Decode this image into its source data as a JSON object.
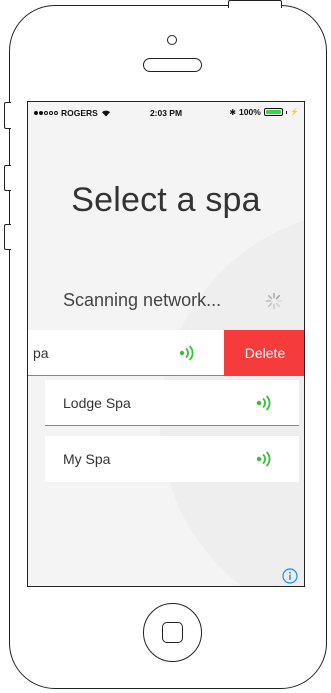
{
  "status_bar": {
    "carrier": "ROGERS",
    "signal_dots": [
      true,
      true,
      false,
      false,
      false
    ],
    "time": "2:03 PM",
    "battery_percent": "100%",
    "battery_level": 1.0,
    "icons": [
      "wifi-icon",
      "bluetooth-icon",
      "battery-icon",
      "charging-bolt-icon"
    ]
  },
  "title": "Select a spa",
  "scanning_text": "Scanning network...",
  "spas": [
    {
      "name": "pa",
      "signal_icon": "wifi-signal-icon",
      "swiped": true,
      "delete_label": "Delete"
    },
    {
      "name": "Lodge Spa",
      "signal_icon": "wifi-signal-icon",
      "swiped": false
    },
    {
      "name": "My Spa",
      "signal_icon": "wifi-signal-icon",
      "swiped": false
    }
  ],
  "colors": {
    "signal_green": "#2ec234",
    "delete_red": "#f53b3b",
    "info_blue": "#1f8fe8",
    "battery_green": "#3bd34f",
    "screen_bg": "#f4f4f4"
  }
}
